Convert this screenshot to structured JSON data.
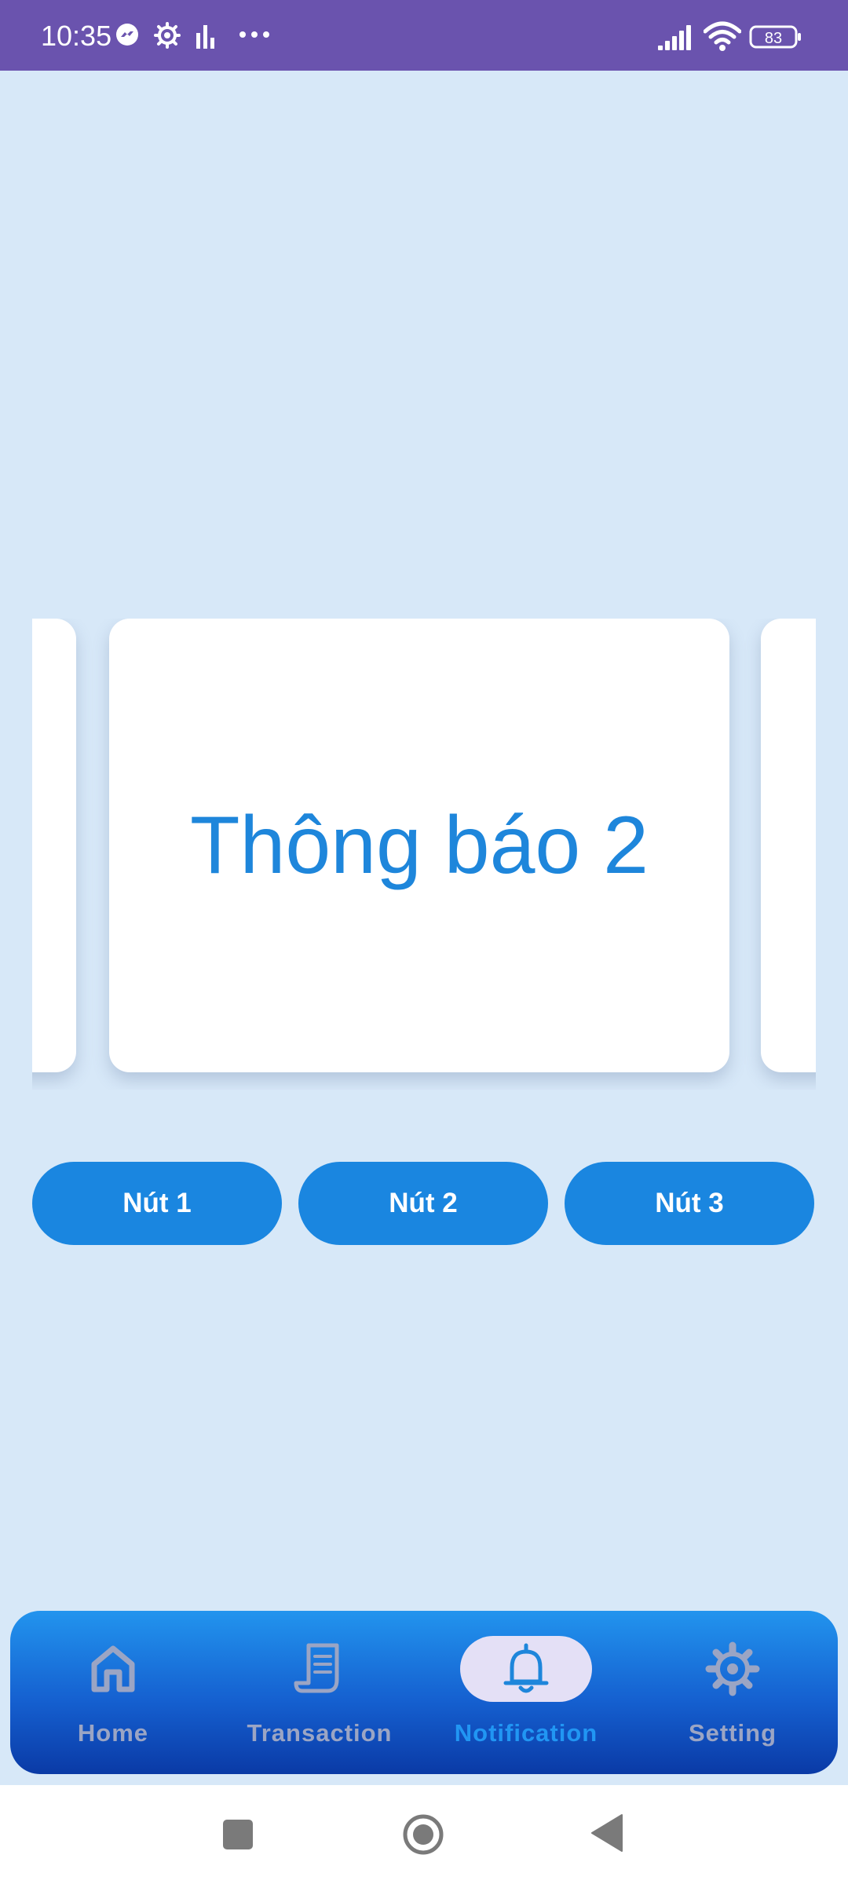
{
  "status_bar": {
    "time": "10:35",
    "battery": "83",
    "icons": [
      "messenger-icon",
      "gear-icon",
      "chart-icon",
      "more-icon",
      "signal-icon",
      "wifi-icon",
      "battery-icon"
    ]
  },
  "carousel": {
    "current_title": "Thông báo 2"
  },
  "buttons": [
    {
      "label": "Nút 1"
    },
    {
      "label": "Nút 2"
    },
    {
      "label": "Nút 3"
    }
  ],
  "bottom_nav": {
    "items": [
      {
        "label": "Home",
        "icon": "home-icon",
        "active": false
      },
      {
        "label": "Transaction",
        "icon": "receipt-icon",
        "active": false
      },
      {
        "label": "Notification",
        "icon": "bell-icon",
        "active": true
      },
      {
        "label": "Setting",
        "icon": "gear-icon",
        "active": false
      }
    ]
  },
  "colors": {
    "background": "#D7E8F8",
    "status_bar": "#6A53AE",
    "accent": "#1E86DB",
    "button": "#1A86E0",
    "nav_active": "#2196F3",
    "nav_inactive": "#9BA5C4",
    "nav_pill": "#E4E0F6"
  }
}
